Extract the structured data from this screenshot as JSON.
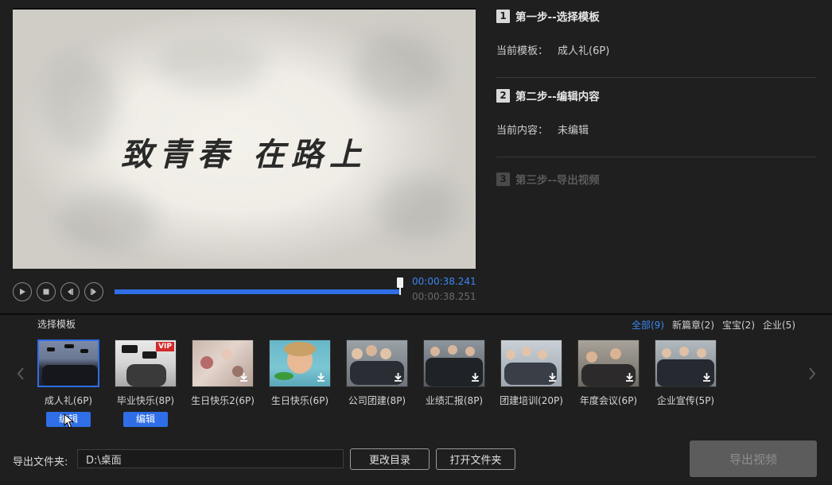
{
  "preview": {
    "title": "致青春 在路上"
  },
  "playback": {
    "current_time": "00:00:38.241",
    "total_time": "00:00:38.251",
    "progress": 0.995,
    "controls": [
      "play-icon",
      "stop-icon",
      "prev-frame-icon",
      "next-frame-icon"
    ]
  },
  "steps": {
    "step1": {
      "num": "1",
      "title": "第一步--选择模板",
      "info_label": "当前模板：",
      "info_value": "成人礼(6P)"
    },
    "step2": {
      "num": "2",
      "title": "第二步--编辑内容",
      "info_label": "当前内容：",
      "info_value": "未编辑"
    },
    "step3": {
      "num": "3",
      "title": "第三步--导出视频"
    }
  },
  "templates": {
    "section_label": "选择模板",
    "filters": [
      "全部(9)",
      "新篇章(2)",
      "宝宝(2)",
      "企业(5)"
    ],
    "active_filter": 0,
    "edit_label": "编辑",
    "items": [
      {
        "name": "成人礼(6P)",
        "selected": true,
        "downloaded": true
      },
      {
        "name": "毕业快乐(8P)",
        "selected": false,
        "downloaded": true,
        "badge": "VIP"
      },
      {
        "name": "生日快乐2(6P)",
        "selected": false,
        "downloaded": false
      },
      {
        "name": "生日快乐(6P)",
        "selected": false,
        "downloaded": false
      },
      {
        "name": "公司团建(8P)",
        "selected": false,
        "downloaded": false
      },
      {
        "name": "业绩汇报(8P)",
        "selected": false,
        "downloaded": false
      },
      {
        "name": "团建培训(20P)",
        "selected": false,
        "downloaded": false
      },
      {
        "name": "年度会议(6P)",
        "selected": false,
        "downloaded": false
      },
      {
        "name": "企业宣传(5P)",
        "selected": false,
        "downloaded": false
      }
    ]
  },
  "export": {
    "folder_label": "导出文件夹:",
    "folder_path": "D:\\桌面",
    "change_dir_label": "更改目录",
    "open_folder_label": "打开文件夹",
    "export_label": "导出视频"
  },
  "colors": {
    "accent": "#2f6ee6",
    "time_current": "#3a87f2",
    "background": "#1f1f1f"
  }
}
